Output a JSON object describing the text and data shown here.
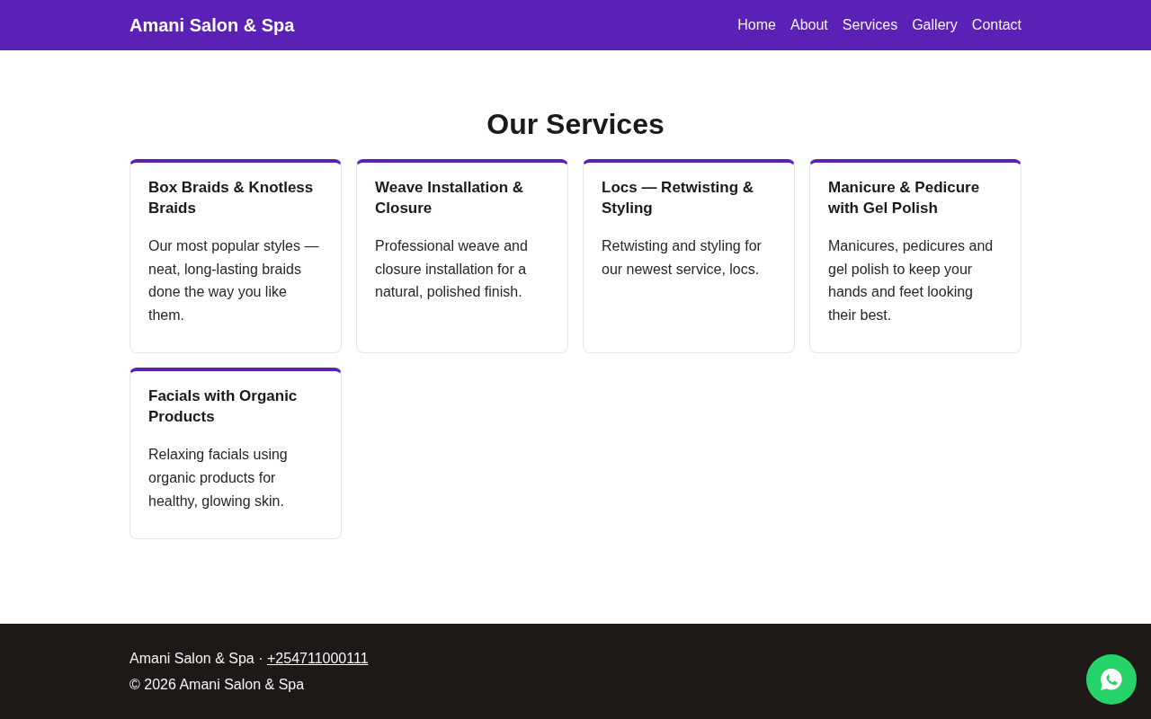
{
  "header": {
    "brand": "Amani Salon & Spa",
    "nav": [
      "Home",
      "About",
      "Services",
      "Gallery",
      "Contact"
    ]
  },
  "services": {
    "heading": "Our Services",
    "cards": [
      {
        "title": "Box Braids & Knotless Braids",
        "description": "Our most popular styles — neat, long-lasting braids done the way you like them."
      },
      {
        "title": "Weave Installation & Closure",
        "description": "Professional weave and closure installation for a natural, polished finish."
      },
      {
        "title": "Locs — Retwisting & Styling",
        "description": "Retwisting and styling for our newest service, locs."
      },
      {
        "title": "Manicure & Pedicure with Gel Polish",
        "description": "Manicures, pedicures and gel polish to keep your hands and feet looking their best."
      },
      {
        "title": "Facials with Organic Products",
        "description": "Relaxing facials using organic products for healthy, glowing skin."
      }
    ]
  },
  "footer": {
    "business_line": "Amani Salon & Spa ·",
    "phone": "+254711000111",
    "copyright": "© 2026 Amani Salon & Spa"
  }
}
